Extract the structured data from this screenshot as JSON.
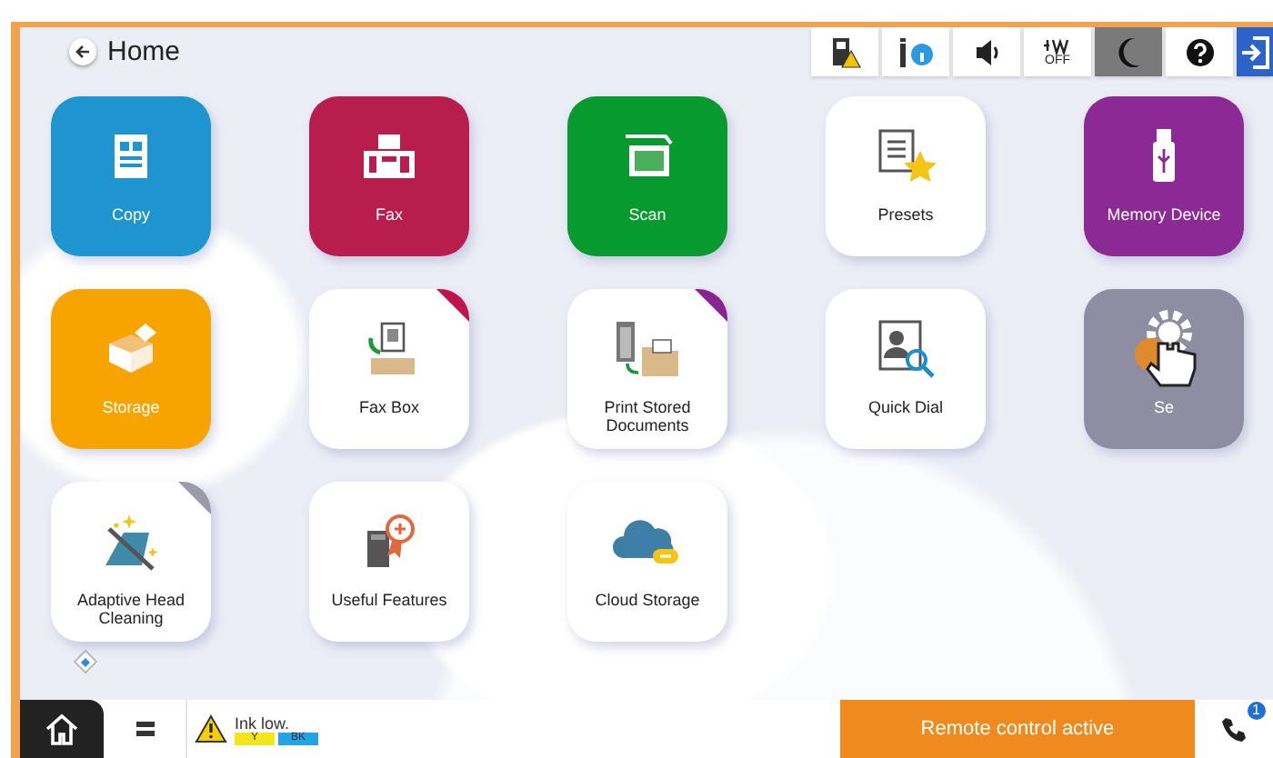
{
  "header": {
    "title": "Home"
  },
  "status_icons": [
    {
      "kind": "printer-alert",
      "on": false
    },
    {
      "kind": "ink-info",
      "on": false
    },
    {
      "kind": "sound",
      "on": false
    },
    {
      "kind": "wifi-off",
      "on": false,
      "label": "OFF"
    },
    {
      "kind": "moon",
      "on": true
    },
    {
      "kind": "help",
      "on": false
    },
    {
      "kind": "exit",
      "on": true
    }
  ],
  "tiles": [
    {
      "label": "Copy",
      "kind": "solid",
      "color": "#1f95d0"
    },
    {
      "label": "Fax",
      "kind": "solid",
      "color": "#b81e4d"
    },
    {
      "label": "Scan",
      "kind": "solid",
      "color": "#079a2e"
    },
    {
      "label": "Presets",
      "kind": "plain"
    },
    {
      "label": "Memory Device",
      "kind": "solid",
      "color": "#8b2a94"
    },
    {
      "label": "Storage",
      "kind": "solid",
      "color": "#f7a400"
    },
    {
      "label": "Fax Box",
      "kind": "plain",
      "color": "#c0154c"
    },
    {
      "label": "Print Stored Documents",
      "kind": "plain",
      "color": "#8a2392"
    },
    {
      "label": "Quick Dial",
      "kind": "plain"
    },
    {
      "label": "Se",
      "kind": "solid",
      "color": "#8f8da1"
    },
    {
      "label": "Adaptive Head Cleaning",
      "kind": "plain",
      "color": "#9b99aa"
    },
    {
      "label": "Useful Features",
      "kind": "plain"
    },
    {
      "label": "Cloud Storage",
      "kind": "plain"
    }
  ],
  "footer": {
    "ink_status": "Ink low.",
    "inks": [
      {
        "label": "Y",
        "color": "#f5e51b"
      },
      {
        "label": "BK",
        "color": "#23a3e6"
      }
    ],
    "remote": "Remote control active",
    "badge": "1"
  }
}
